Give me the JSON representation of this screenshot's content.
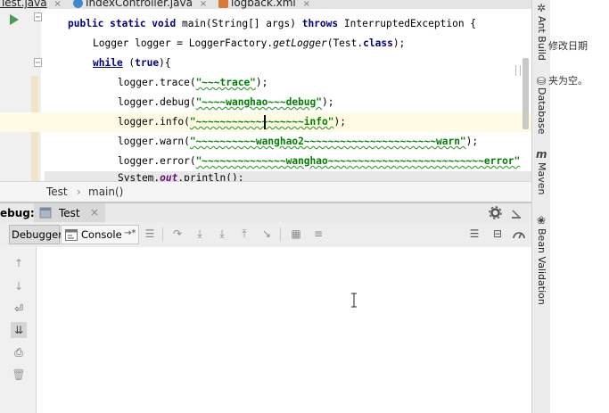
{
  "tabs": [
    {
      "label": "Test.java",
      "close": "×",
      "active": true
    },
    {
      "label": "IndexController.java",
      "close": "×"
    },
    {
      "label": "logback.xml",
      "close": "×"
    }
  ],
  "code": {
    "l1": {
      "kw1": "public static void",
      "t1": " main(String[] args) ",
      "kw2": "throws",
      "t2": " InterruptedException {"
    },
    "l2": {
      "t1": "Logger logger = LoggerFactory.",
      "it": "getLogger",
      "t2": "(Test.",
      "kw": "class",
      "t3": ");"
    },
    "l3": {
      "kw1": "while",
      "t1": " (",
      "kw2": "true",
      "t2": "){"
    },
    "l4": {
      "t1": "logger.trace(",
      "s": "\"~~~trace\"",
      "t2": ");"
    },
    "l5": {
      "t1": "logger.debug(",
      "s": "\"~~~~wanghao~~~debug\"",
      "t2": ");"
    },
    "l6": {
      "t1": "logger.info(",
      "s": "\"~~~~~~~~~~~~~~~~~~info\"",
      "t2": ");"
    },
    "l7": {
      "t1": "logger.warn(",
      "s": "\"~~~~~~~~~~wanghao2~~~~~~~~~~~~~~~~~~~~~~warn\"",
      "t2": ");"
    },
    "l8": {
      "t1": "logger.error(",
      "s": "\"~~~~~~~~~~~~~~wanghao~~~~~~~~~~~~~~~~~~~~~~~~~~error\"",
      "t2": ""
    },
    "l9": {
      "t1": "System.",
      "f": "out",
      "t2": ".println();"
    }
  },
  "breadcrumb": {
    "item1": "Test",
    "sep": "›",
    "item2": "main()"
  },
  "debug": {
    "label": "ebug:",
    "run_config": "Test",
    "close": "×"
  },
  "debug_tabs": {
    "debugger": "Debugger",
    "console": "Console",
    "console_suffix": "→*"
  },
  "right_tools": [
    "Ant Build",
    "Database",
    "Maven",
    "Bean Validation"
  ],
  "outer_text": {
    "t1": "修改日期",
    "t2": "夹为空。"
  }
}
